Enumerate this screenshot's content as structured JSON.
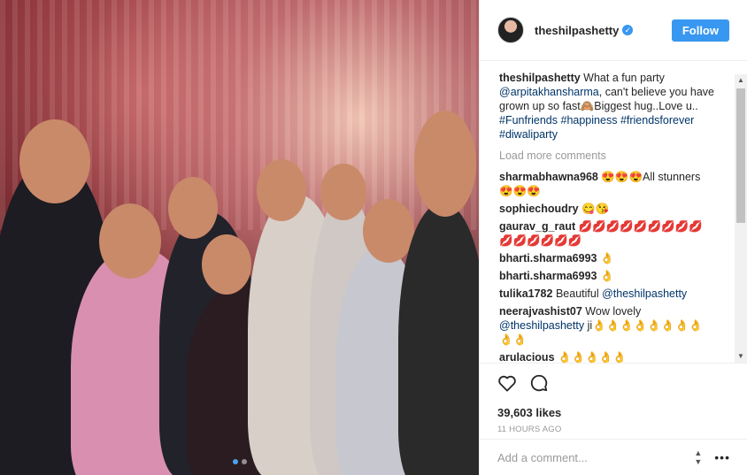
{
  "post": {
    "username": "theshilpashetty",
    "follow_label": "Follow",
    "caption_user": "theshilpashetty",
    "caption_text_1": "What a fun party",
    "caption_mention": "@arpitakhansharma",
    "caption_text_2": ", can't believe you have grown up so fast🙈Biggest hug..Love u..",
    "hashtags": [
      "#Funfriends",
      "#happiness",
      "#friendsforever",
      "#diwaliparty"
    ],
    "load_more": "Load more comments",
    "likes": "39,603 likes",
    "timestamp": "11 HOURS AGO",
    "comment_placeholder": "Add a comment..."
  },
  "comments": [
    {
      "user": "sharmabhawna968",
      "text": "😍😍😍All stunners 😍😍😍",
      "mention": ""
    },
    {
      "user": "sophiechoudry",
      "text": "😋😘",
      "mention": ""
    },
    {
      "user": "gaurav_g_raut",
      "text": "💋💋💋💋💋💋💋💋💋💋💋💋💋💋💋",
      "mention": ""
    },
    {
      "user": "bharti.sharma6993",
      "text": "👌",
      "mention": ""
    },
    {
      "user": "bharti.sharma6993",
      "text": "👌",
      "mention": ""
    },
    {
      "user": "tulika1782",
      "text": "Beautiful",
      "mention": "@theshilpashetty"
    },
    {
      "user": "neerajvashist07",
      "text": "Wow lovely",
      "mention": "@theshilpashetty",
      "suffix": "ji👌👌👌👌👌👌👌👌👌👌"
    },
    {
      "user": "arulacious",
      "text": "👌👌👌👌👌",
      "mention": ""
    }
  ],
  "icons": {
    "like": "heart-icon",
    "comment": "comment-icon",
    "verified": "verified-badge-icon",
    "more": "more-options-icon"
  },
  "colors": {
    "accent": "#3897f0",
    "link": "#003569",
    "muted": "#999999"
  }
}
